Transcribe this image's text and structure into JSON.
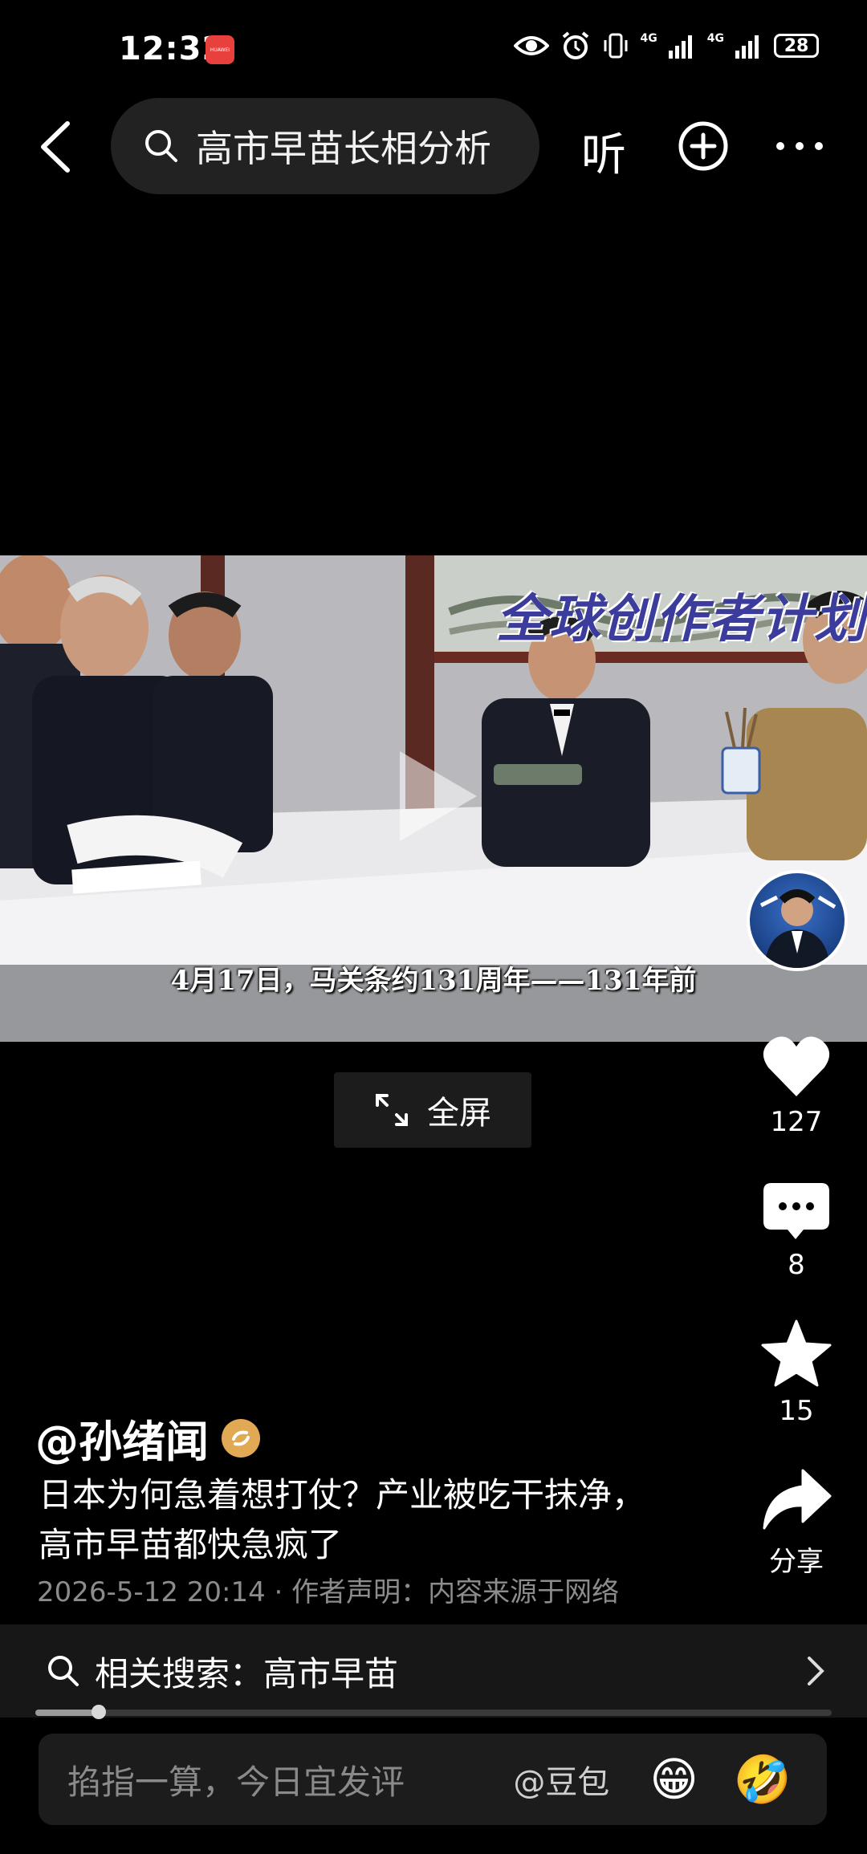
{
  "status_bar": {
    "time": "12:32",
    "app_badge": "HUAWEI",
    "network_1": "4G",
    "network_2": "4G",
    "battery": "28"
  },
  "header": {
    "search_query": "高市早苗长相分析",
    "listen_label": "听"
  },
  "video": {
    "watermark": "全球创作者计划",
    "subtitle": "4月17日，马关条约131周年——131年前",
    "fullscreen_label": "全屏"
  },
  "actions": {
    "likes": "127",
    "comments": "8",
    "favorites": "15",
    "share_label": "分享"
  },
  "post": {
    "author": "@孙绪闻",
    "description": "日本为何急着想打仗？产业被吃干抹净，高市早苗都快急疯了",
    "meta": "2026-5-12 20:14 · 作者声明：内容来源于网络"
  },
  "related_search": {
    "label": "相关搜索：高市早苗"
  },
  "playback": {
    "progress": 0.08
  },
  "comment_bar": {
    "placeholder": "掐指一算，今日宜发评",
    "mention": "@豆包",
    "emoji_1": "😁",
    "emoji_2": "🤣"
  }
}
